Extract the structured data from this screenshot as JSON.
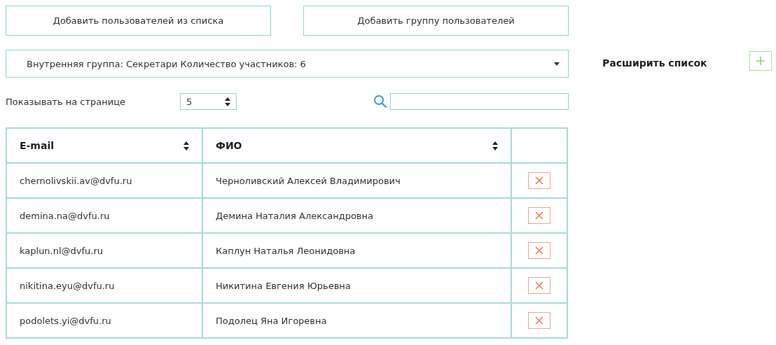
{
  "buttons": [
    "Добавить пользователей из списка",
    "Добавить группу пользователей"
  ],
  "group_select": {
    "value": "Внутренняя группа: Секретари Количество участников: 6"
  },
  "expand": {
    "label": "Расширить список"
  },
  "page_size": {
    "label": "Показывать на странице",
    "value": "5"
  },
  "table": {
    "columns": [
      "E-mail",
      "ФИО"
    ],
    "rows": [
      {
        "email": "chernolivskii.av@dvfu.ru",
        "name": "Черноливский Алексей Владимирович"
      },
      {
        "email": "demina.na@dvfu.ru",
        "name": "Демина Наталия Александровна"
      },
      {
        "email": "kaplun.nl@dvfu.ru",
        "name": "Каплун Наталья Леонидовна"
      },
      {
        "email": "nikitina.eyu@dvfu.ru",
        "name": "Никитина Евгения Юрьевна"
      },
      {
        "email": "podolets.yi@dvfu.ru",
        "name": "Подолец Яна Игоревна"
      }
    ]
  }
}
